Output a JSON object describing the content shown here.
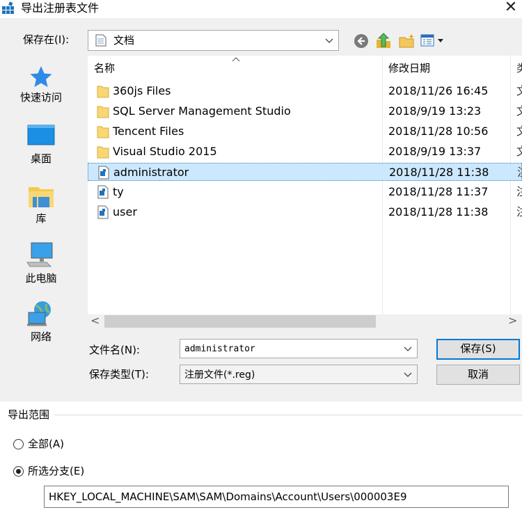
{
  "window": {
    "title": "导出注册表文件",
    "close_glyph": "✕"
  },
  "save_in": {
    "label": "保存在(I):",
    "value": "文档"
  },
  "toolbar": {
    "back_icon": "back-arrow-icon",
    "up_icon": "up-folder-icon",
    "new_folder_icon": "new-folder-icon",
    "view_icon": "view-menu-icon"
  },
  "places": [
    {
      "name": "quick-access",
      "label": "快速访问",
      "icon": "star-icon"
    },
    {
      "name": "desktop",
      "label": "桌面",
      "icon": "desktop-icon"
    },
    {
      "name": "libraries",
      "label": "库",
      "icon": "library-icon"
    },
    {
      "name": "this-pc",
      "label": "此电脑",
      "icon": "computer-icon"
    },
    {
      "name": "network",
      "label": "网络",
      "icon": "network-icon"
    }
  ],
  "file_list": {
    "columns": [
      "名称",
      "修改日期",
      "类"
    ],
    "rows": [
      {
        "name": "360js Files",
        "date": "2018/11/26 16:45",
        "type": "文",
        "kind": "folder",
        "selected": false
      },
      {
        "name": "SQL Server Management Studio",
        "date": "2018/9/19 13:23",
        "type": "文",
        "kind": "folder",
        "selected": false
      },
      {
        "name": "Tencent Files",
        "date": "2018/11/28 10:56",
        "type": "文",
        "kind": "folder",
        "selected": false
      },
      {
        "name": "Visual Studio 2015",
        "date": "2018/9/19 13:37",
        "type": "文",
        "kind": "folder",
        "selected": false
      },
      {
        "name": "administrator",
        "date": "2018/11/28 11:38",
        "type": "注",
        "kind": "reg",
        "selected": true
      },
      {
        "name": "ty",
        "date": "2018/11/28 11:37",
        "type": "注",
        "kind": "reg",
        "selected": false
      },
      {
        "name": "user",
        "date": "2018/11/28 11:38",
        "type": "注",
        "kind": "reg",
        "selected": false
      }
    ]
  },
  "scrollbar": {
    "left": "<",
    "right": ">"
  },
  "filename": {
    "label": "文件名(N):",
    "value": "administrator"
  },
  "filetype": {
    "label": "保存类型(T):",
    "value": "注册文件(*.reg)"
  },
  "buttons": {
    "save": "保存(S)",
    "cancel": "取消"
  },
  "export_range": {
    "title": "导出范围",
    "all_label": "全部(A)",
    "branch_label": "所选分支(E)",
    "selected": "branch",
    "branch_value": "HKEY_LOCAL_MACHINE\\SAM\\SAM\\Domains\\Account\\Users\\000003E9"
  },
  "colors": {
    "selection": "#cce8ff",
    "accent": "#0078d7",
    "folder": "#f8d775"
  }
}
